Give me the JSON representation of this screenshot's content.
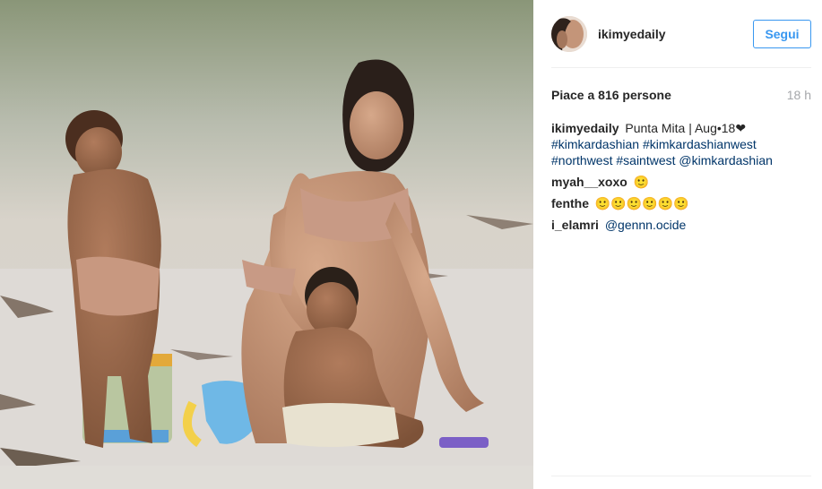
{
  "post": {
    "username": "ikimyedaily",
    "follow_label": "Segui",
    "likes_text": "Piace a 816 persone",
    "time_text": "18 h",
    "caption": {
      "username": "ikimyedaily",
      "text": "Punta Mita | Aug•18❤",
      "hashtags": [
        "#kimkardashian",
        "#kimkardashianwest",
        "#northwest",
        "#saintwest",
        "@kimkardashian"
      ]
    },
    "comments": [
      {
        "username": "myah__xoxo",
        "text": "🙂"
      },
      {
        "username": "fenthe",
        "text": "🙂🙂🙂🙂🙂🙂"
      },
      {
        "username": "i_elamri",
        "text": "@gennn.ocide"
      }
    ]
  },
  "icons": {
    "avatar": "profile-photo",
    "photo": "beach-photo"
  }
}
